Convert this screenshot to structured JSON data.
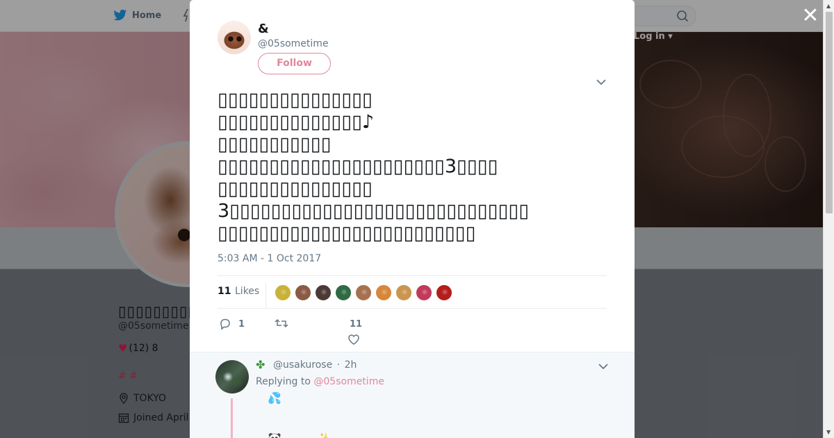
{
  "nav": {
    "home_label": "Home",
    "login_label": "Log in"
  },
  "profile": {
    "name": "▯▯▯▯▯▯▯▯▯▯▯▯▯",
    "handle": "@05sometime",
    "bio_counts": "(12) 8",
    "hashtags": "# #",
    "location": "TOKYO",
    "joined": "Joined April"
  },
  "tweet": {
    "author_name": "&",
    "author_handle": "@05sometime",
    "follow_label": "Follow",
    "lines": [
      "▯▯▯▯▯▯▯▯▯▯▯▯▯▯▯",
      "▯▯▯▯▯▯▯▯▯▯▯▯▯▯♪",
      "▯▯▯▯▯▯▯▯▯▯▯",
      "▯▯▯▯▯▯▯▯▯▯▯▯▯▯▯▯▯▯▯▯▯▯3▯▯▯▯",
      "▯▯▯▯▯▯▯▯▯▯▯▯▯▯▯",
      "3▯▯▯▯▯▯▯▯▯▯▯▯▯▯▯▯▯▯▯▯▯▯▯▯▯▯▯▯▯",
      "▯▯▯▯▯▯▯▯▯▯▯▯▯▯▯▯▯▯▯▯▯▯▯▯▯"
    ],
    "timestamp": "5:03 AM - 1 Oct 2017",
    "likes_count": "11",
    "likes_label": "Likes",
    "reply_count": "1",
    "like_count_action": "11"
  },
  "likers": [
    {
      "color": "#c8b23a"
    },
    {
      "color": "#8b5a44"
    },
    {
      "color": "#4a3a36"
    },
    {
      "color": "#2f6a42"
    },
    {
      "color": "#a7704f"
    },
    {
      "color": "#d8873a"
    },
    {
      "color": "#c9954f"
    },
    {
      "color": "#c23a5a"
    },
    {
      "color": "#b51d1d"
    }
  ],
  "reply": {
    "handle": "@usakurose",
    "age": "2h",
    "replying_prefix": "Replying to",
    "replying_to": "@05sometime"
  },
  "colors": {
    "accent": "#e0879b",
    "muted": "#657786"
  }
}
